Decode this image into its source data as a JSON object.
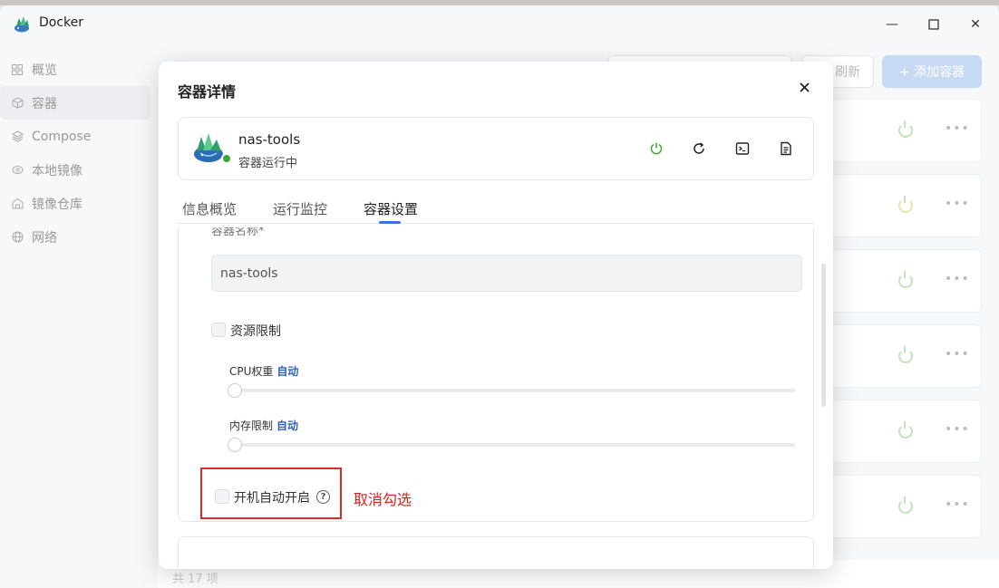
{
  "window": {
    "title": "Docker",
    "minimize_symbol": "—",
    "maximize_symbol": "☐",
    "close_symbol": "✕"
  },
  "sidebar": {
    "items": [
      {
        "label": "概览",
        "icon": "grid-icon"
      },
      {
        "label": "容器",
        "icon": "cube-icon",
        "active": true
      },
      {
        "label": "Compose",
        "icon": "layers-icon"
      },
      {
        "label": "本地镜像",
        "icon": "disc-icon"
      },
      {
        "label": "镜像仓库",
        "icon": "warehouse-icon"
      },
      {
        "label": "网络",
        "icon": "globe-icon"
      }
    ]
  },
  "background": {
    "refresh_label": "刷新",
    "add_label": "+ 添加容器",
    "total_label": "共 17 项",
    "power_color": "#c4e3bb"
  },
  "modal": {
    "title": "容器详情",
    "close_symbol": "×",
    "container": {
      "name": "nas-tools",
      "status": "容器运行中",
      "status_color": "#3ea536"
    },
    "actions": [
      "power-icon",
      "restart-icon",
      "terminal-icon",
      "logs-icon"
    ],
    "tabs": [
      "信息概览",
      "运行监控",
      "容器设置"
    ],
    "active_tab": "容器设置",
    "settings": {
      "name_label": "容器名称*",
      "name_value": "nas-tools",
      "resource_limit_label": "资源限制",
      "resource_limit_checked": false,
      "cpu_label": "CPU权重",
      "cpu_value": "自动",
      "cpu_slider_value": 0,
      "memory_label": "内存限制",
      "memory_value": "自动",
      "memory_slider_value": 0,
      "autostart_label": "开机自动开启",
      "autostart_checked": false,
      "help_symbol": "?"
    }
  },
  "annotation": {
    "text": "取消勾选",
    "color": "#e02020"
  }
}
